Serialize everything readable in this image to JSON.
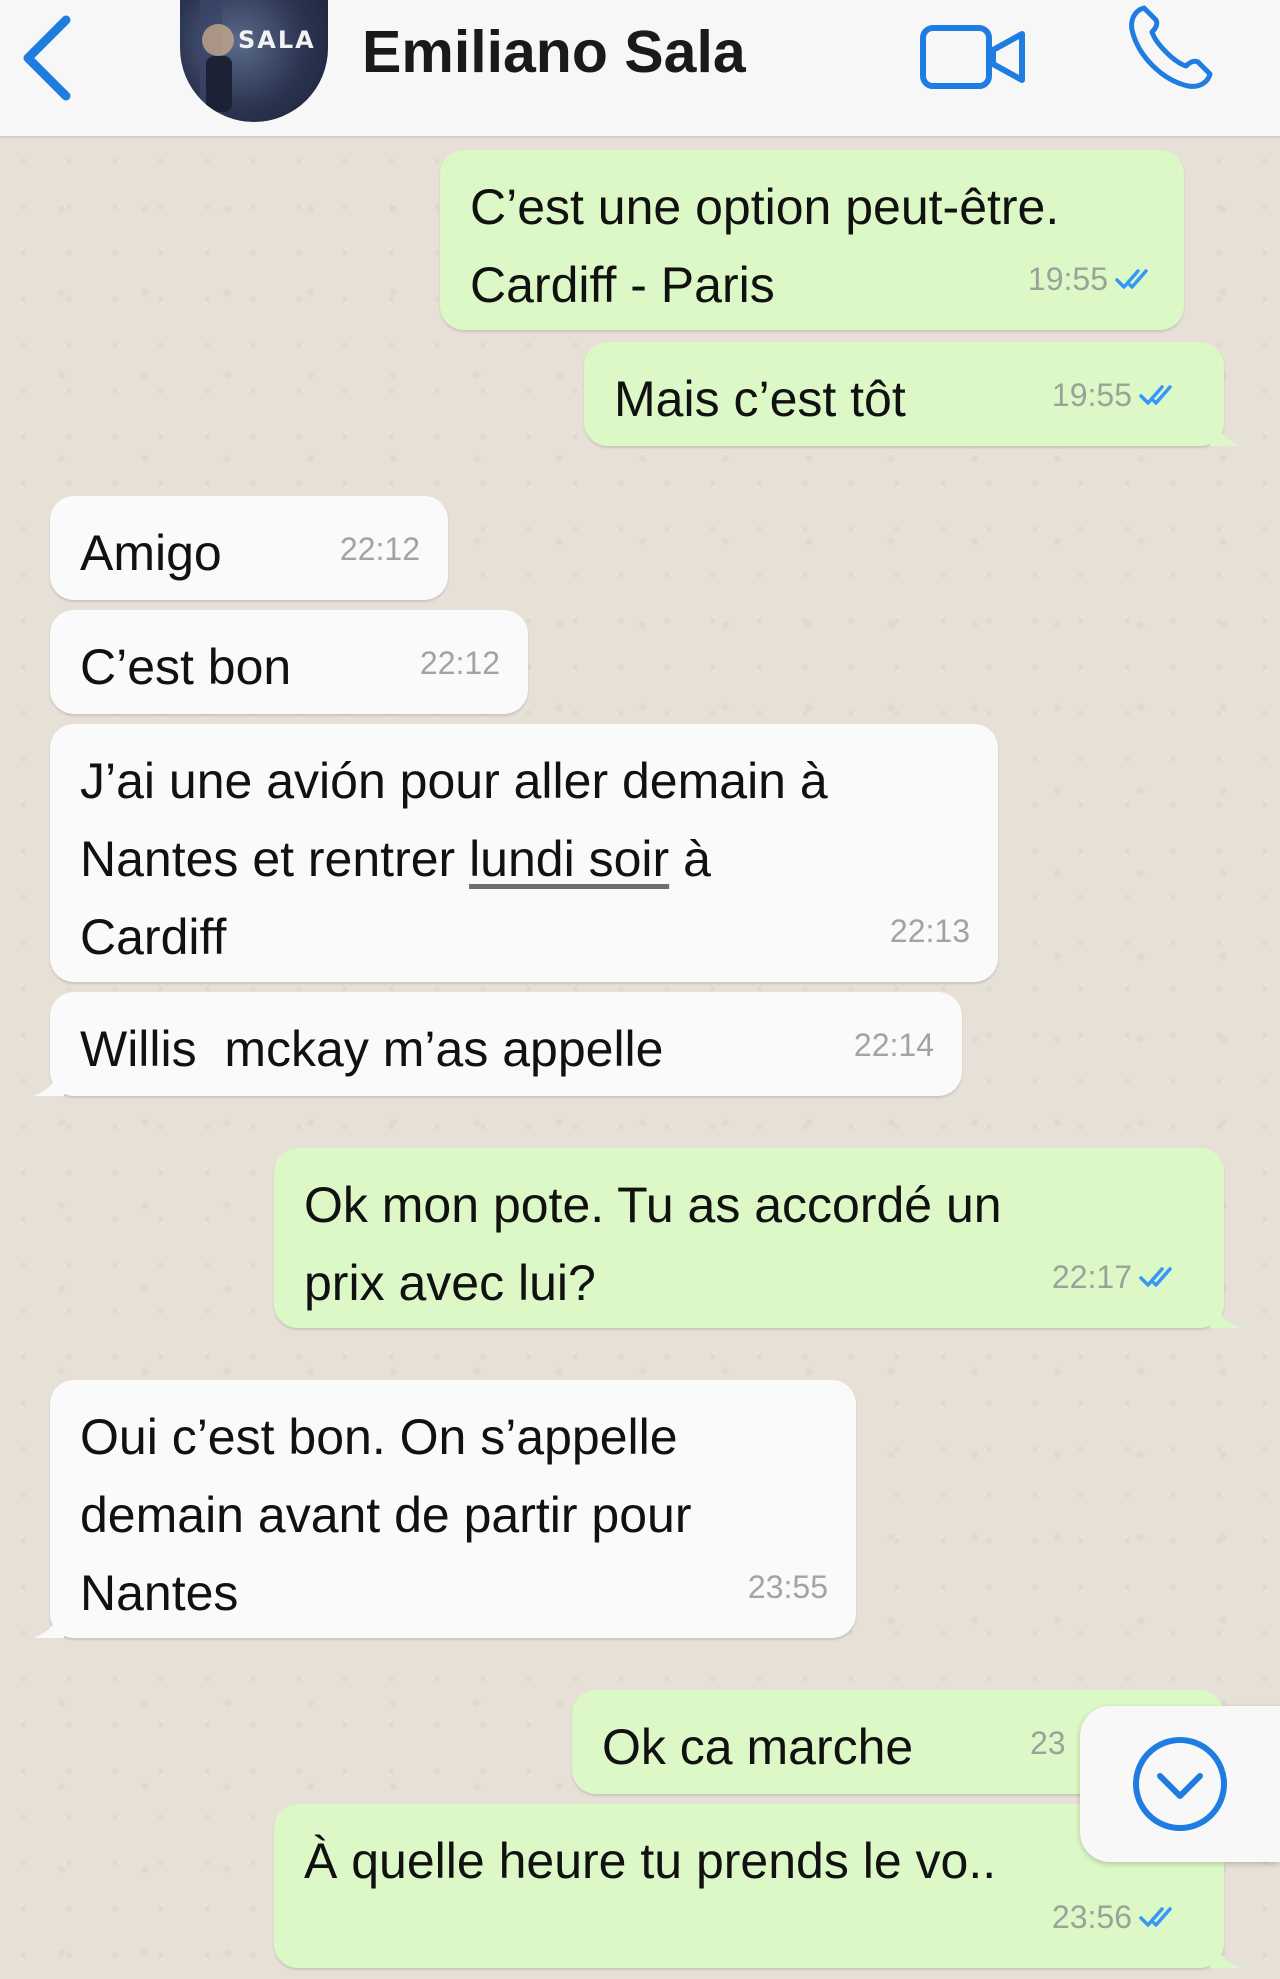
{
  "header": {
    "contact_name": "Emiliano Sala",
    "avatar_text": "SALA",
    "back_icon": "chevron-left-icon",
    "video_icon": "video-camera-icon",
    "call_icon": "phone-icon"
  },
  "colors": {
    "accent": "#1f7ce0",
    "outgoing_bubble": "#dcf8c6",
    "incoming_bubble": "#fafafa",
    "chat_background": "#e6e0d7",
    "read_ticks": "#3497f9"
  },
  "messages": [
    {
      "direction": "out",
      "text": "C’est une option peut-être.\nCardiff - Paris",
      "time": "19:55",
      "status": "read"
    },
    {
      "direction": "out",
      "text": "Mais c’est tôt",
      "time": "19:55",
      "status": "read"
    },
    {
      "direction": "in",
      "text": "Amigo",
      "time": "22:12"
    },
    {
      "direction": "in",
      "text": "C’est bon",
      "time": "22:12"
    },
    {
      "direction": "in",
      "text_before": "J’ai une avión pour aller demain à\nNantes et rentrer ",
      "link": "lundi soir",
      "text_after": " à\nCardiff",
      "time": "22:13"
    },
    {
      "direction": "in",
      "text": "Willis  mckay m’as appelle",
      "time": "22:14"
    },
    {
      "direction": "out",
      "text": "Ok mon pote. Tu as accordé un\nprix avec lui?",
      "time": "22:17",
      "status": "read"
    },
    {
      "direction": "in",
      "text": "Oui c’est bon. On s’appelle\ndemain avant de partir pour\nNantes",
      "time": "23:55"
    },
    {
      "direction": "out",
      "text": "Ok ca marche",
      "time": "23",
      "status": "read"
    },
    {
      "direction": "out",
      "text": "À quelle heure tu prends le vo..",
      "time": "23:56",
      "status": "read"
    }
  ],
  "scroll_button_icon": "chevron-down-circle-icon"
}
